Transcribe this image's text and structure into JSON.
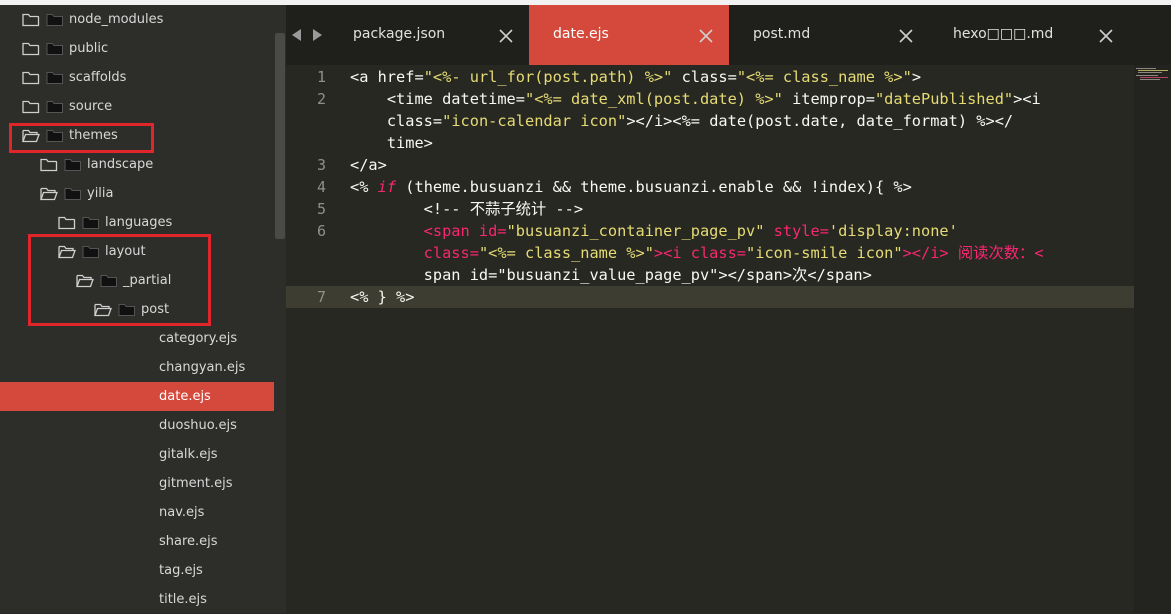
{
  "sidebar": {
    "items": [
      {
        "label": "node_modules",
        "type": "folder",
        "open": false
      },
      {
        "label": "public",
        "type": "folder",
        "open": false
      },
      {
        "label": "scaffolds",
        "type": "folder",
        "open": false
      },
      {
        "label": "source",
        "type": "folder",
        "open": false
      },
      {
        "label": "themes",
        "type": "folder",
        "open": true
      },
      {
        "label": "landscape",
        "type": "folder",
        "open": false
      },
      {
        "label": "yilia",
        "type": "folder",
        "open": true
      },
      {
        "label": "languages",
        "type": "folder",
        "open": false
      },
      {
        "label": "layout",
        "type": "folder",
        "open": true
      },
      {
        "label": "_partial",
        "type": "folder",
        "open": true
      },
      {
        "label": "post",
        "type": "folder",
        "open": true
      },
      {
        "label": "category.ejs",
        "type": "file"
      },
      {
        "label": "changyan.ejs",
        "type": "file"
      },
      {
        "label": "date.ejs",
        "type": "file",
        "selected": true
      },
      {
        "label": "duoshuo.ejs",
        "type": "file"
      },
      {
        "label": "gitalk.ejs",
        "type": "file"
      },
      {
        "label": "gitment.ejs",
        "type": "file"
      },
      {
        "label": "nav.ejs",
        "type": "file"
      },
      {
        "label": "share.ejs",
        "type": "file"
      },
      {
        "label": "tag.ejs",
        "type": "file"
      },
      {
        "label": "title.ejs",
        "type": "file"
      }
    ]
  },
  "tabs": [
    {
      "label": "package.json",
      "active": false
    },
    {
      "label": "date.ejs",
      "active": true
    },
    {
      "label": "post.md",
      "active": false
    },
    {
      "label": "hexo□□□.md",
      "active": false
    }
  ],
  "editor": {
    "line_numbers": [
      "1",
      "2",
      "3",
      "4",
      "5",
      "6",
      "7"
    ],
    "current_line": "7",
    "lines": [
      [
        [
          "w",
          "<a href="
        ],
        [
          "y",
          "\"<%- url_for(post.path) %>\""
        ],
        [
          "w",
          " class="
        ],
        [
          "y",
          "\"<%= class_name %>\""
        ],
        [
          "w",
          ">"
        ]
      ],
      [
        [
          "w",
          "    <time datetime="
        ],
        [
          "y",
          "\"<%= date_xml(post.date) %>\""
        ],
        [
          "w",
          " itemprop="
        ],
        [
          "y",
          "\"datePublished\""
        ],
        [
          "w",
          "><i"
        ]
      ],
      [
        [
          "w",
          "    class="
        ],
        [
          "y",
          "\"icon-calendar icon\""
        ],
        [
          "w",
          "></i><%= date(post.date, date_format) %></"
        ]
      ],
      [
        [
          "w",
          "    time>"
        ]
      ],
      [
        [
          "w",
          "</a>"
        ]
      ],
      [
        [
          "w",
          "<% "
        ],
        [
          "k",
          "if"
        ],
        [
          "w",
          " (theme.busuanzi && theme.busuanzi.enable && !index){ %>"
        ]
      ],
      [
        [
          "w",
          "        <!-- 不蒜子统计 -->"
        ]
      ],
      [
        [
          "p",
          "        <span id="
        ],
        [
          "y",
          "\"busuanzi_container_page_pv\""
        ],
        [
          "p",
          " style="
        ],
        [
          "y",
          "'display:none'"
        ]
      ],
      [
        [
          "p",
          "        class="
        ],
        [
          "y",
          "\"<%= class_name %>\""
        ],
        [
          "p",
          "><i class="
        ],
        [
          "y",
          "\"icon-smile icon\""
        ],
        [
          "p",
          "></i> 阅读次数：<"
        ]
      ],
      [
        [
          "w",
          "        span id=\"busuanzi_value_page_pv\"></span>次</span>"
        ]
      ],
      [
        [
          "w",
          "<% } %>"
        ]
      ]
    ]
  },
  "colors": {
    "accent": "#d4493b",
    "background": "#272822",
    "sidebar": "#2d2d2a",
    "highlight_box": "#e0262a"
  }
}
